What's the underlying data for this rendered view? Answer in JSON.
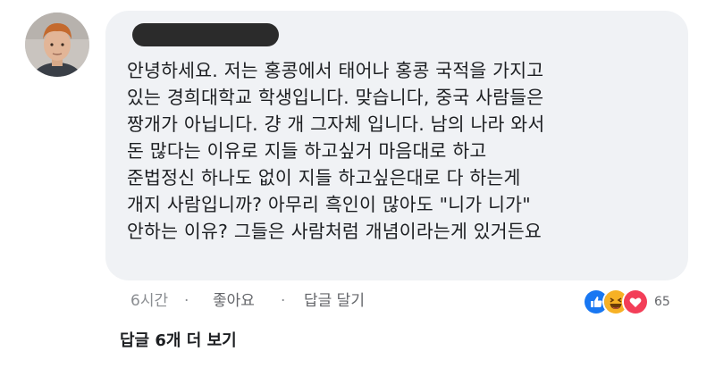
{
  "comment": {
    "author_redacted": true,
    "lines": [
      "안녕하세요. 저는 홍콩에서 태어나 홍콩 국적을 가지고",
      "있는 경희대학교 학생입니다. 맞습니다, 중국 사람들은",
      "짱개가 아닙니다. 걍 개 그자체 입니다. 남의 나라 와서",
      "돈 많다는 이유로 지들 하고싶거 마음대로 하고",
      "준법정신 하나도 없이 지들 하고싶은대로 다 하는게",
      "개지 사람입니까? 아무리 흑인이 많아도 \"니가 니가\"",
      "안하는 이유? 그들은 사람처럼 개념이라는게 있거든요"
    ]
  },
  "actions": {
    "timestamp": "6시간",
    "like_label": "좋아요",
    "reply_label": "답글 달기",
    "separator": "·"
  },
  "reactions": {
    "icons": [
      "like-icon",
      "haha-icon",
      "love-icon"
    ],
    "count": "65",
    "colors": {
      "like": "#1877f2",
      "haha": "#f7b125",
      "love": "#f33e58"
    }
  },
  "more_replies_label": "답글 6개 더 보기"
}
